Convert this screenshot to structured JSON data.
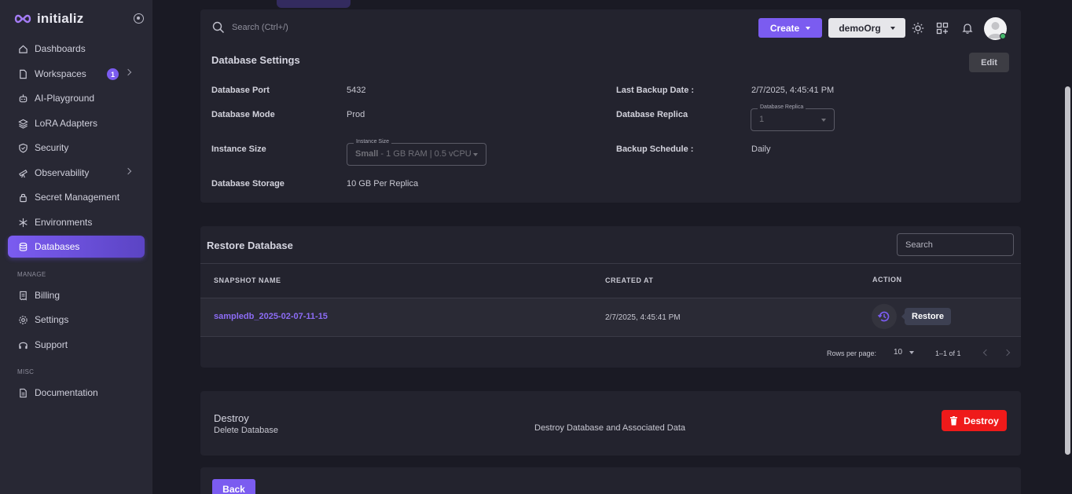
{
  "brand": {
    "name": "initializ"
  },
  "sidebar": {
    "items": [
      {
        "label": "Dashboards",
        "icon": "home-icon"
      },
      {
        "label": "Workspaces",
        "icon": "file-icon",
        "badge": "1"
      },
      {
        "label": "AI-Playground",
        "icon": "robot-icon"
      },
      {
        "label": "LoRA Adapters",
        "icon": "layers-icon"
      },
      {
        "label": "Security",
        "icon": "shield-icon"
      },
      {
        "label": "Observability",
        "icon": "telescope-icon"
      },
      {
        "label": "Secret Management",
        "icon": "lock-icon"
      },
      {
        "label": "Environments",
        "icon": "snowflake-icon"
      },
      {
        "label": "Databases",
        "icon": "database-icon"
      }
    ],
    "manage_label": "MANAGE",
    "manage_items": [
      {
        "label": "Billing",
        "icon": "receipt-icon"
      },
      {
        "label": "Settings",
        "icon": "gear-icon"
      },
      {
        "label": "Support",
        "icon": "headset-icon"
      }
    ],
    "misc_label": "MISC",
    "misc_items": [
      {
        "label": "Documentation",
        "icon": "document-icon"
      }
    ]
  },
  "topbar": {
    "search_placeholder": "Search (Ctrl+/)",
    "create_label": "Create",
    "org_label": "demoOrg"
  },
  "settings": {
    "title": "Database Settings",
    "edit_label": "Edit",
    "port_label": "Database Port",
    "port_value": "5432",
    "mode_label": "Database Mode",
    "mode_value": "Prod",
    "instance_label": "Instance Size",
    "instance_legend": "Instance Size",
    "instance_value_bold": "Small",
    "instance_value_rest": " - 1 GB RAM | 0.5 vCPU",
    "storage_label": "Database Storage",
    "storage_value": "10 GB Per Replica",
    "backup_date_label": "Last Backup Date :",
    "backup_date_value": "2/7/2025, 4:45:41 PM",
    "replica_label": "Database Replica",
    "replica_legend": "Database Replica",
    "replica_value": "1",
    "schedule_label": "Backup Schedule :",
    "schedule_value": "Daily"
  },
  "restore": {
    "title": "Restore Database",
    "search_placeholder": "Search",
    "columns": [
      "SNAPSHOT NAME",
      "CREATED AT",
      "ACTION"
    ],
    "rows": [
      {
        "name": "sampledb_2025-02-07-11-15",
        "created": "2/7/2025, 4:45:41 PM",
        "action_tooltip": "Restore"
      }
    ],
    "rows_per_page_label": "Rows per page:",
    "rows_per_page_value": "10",
    "range": "1–1 of 1"
  },
  "destroy": {
    "title": "Destroy",
    "subtitle": "Delete Database",
    "description": "Destroy Database and Associated Data",
    "button_label": "Destroy"
  },
  "back_label": "Back",
  "colors": {
    "accent": "#7b5cf0",
    "danger": "#ef1a1a",
    "online": "#44b76b"
  }
}
